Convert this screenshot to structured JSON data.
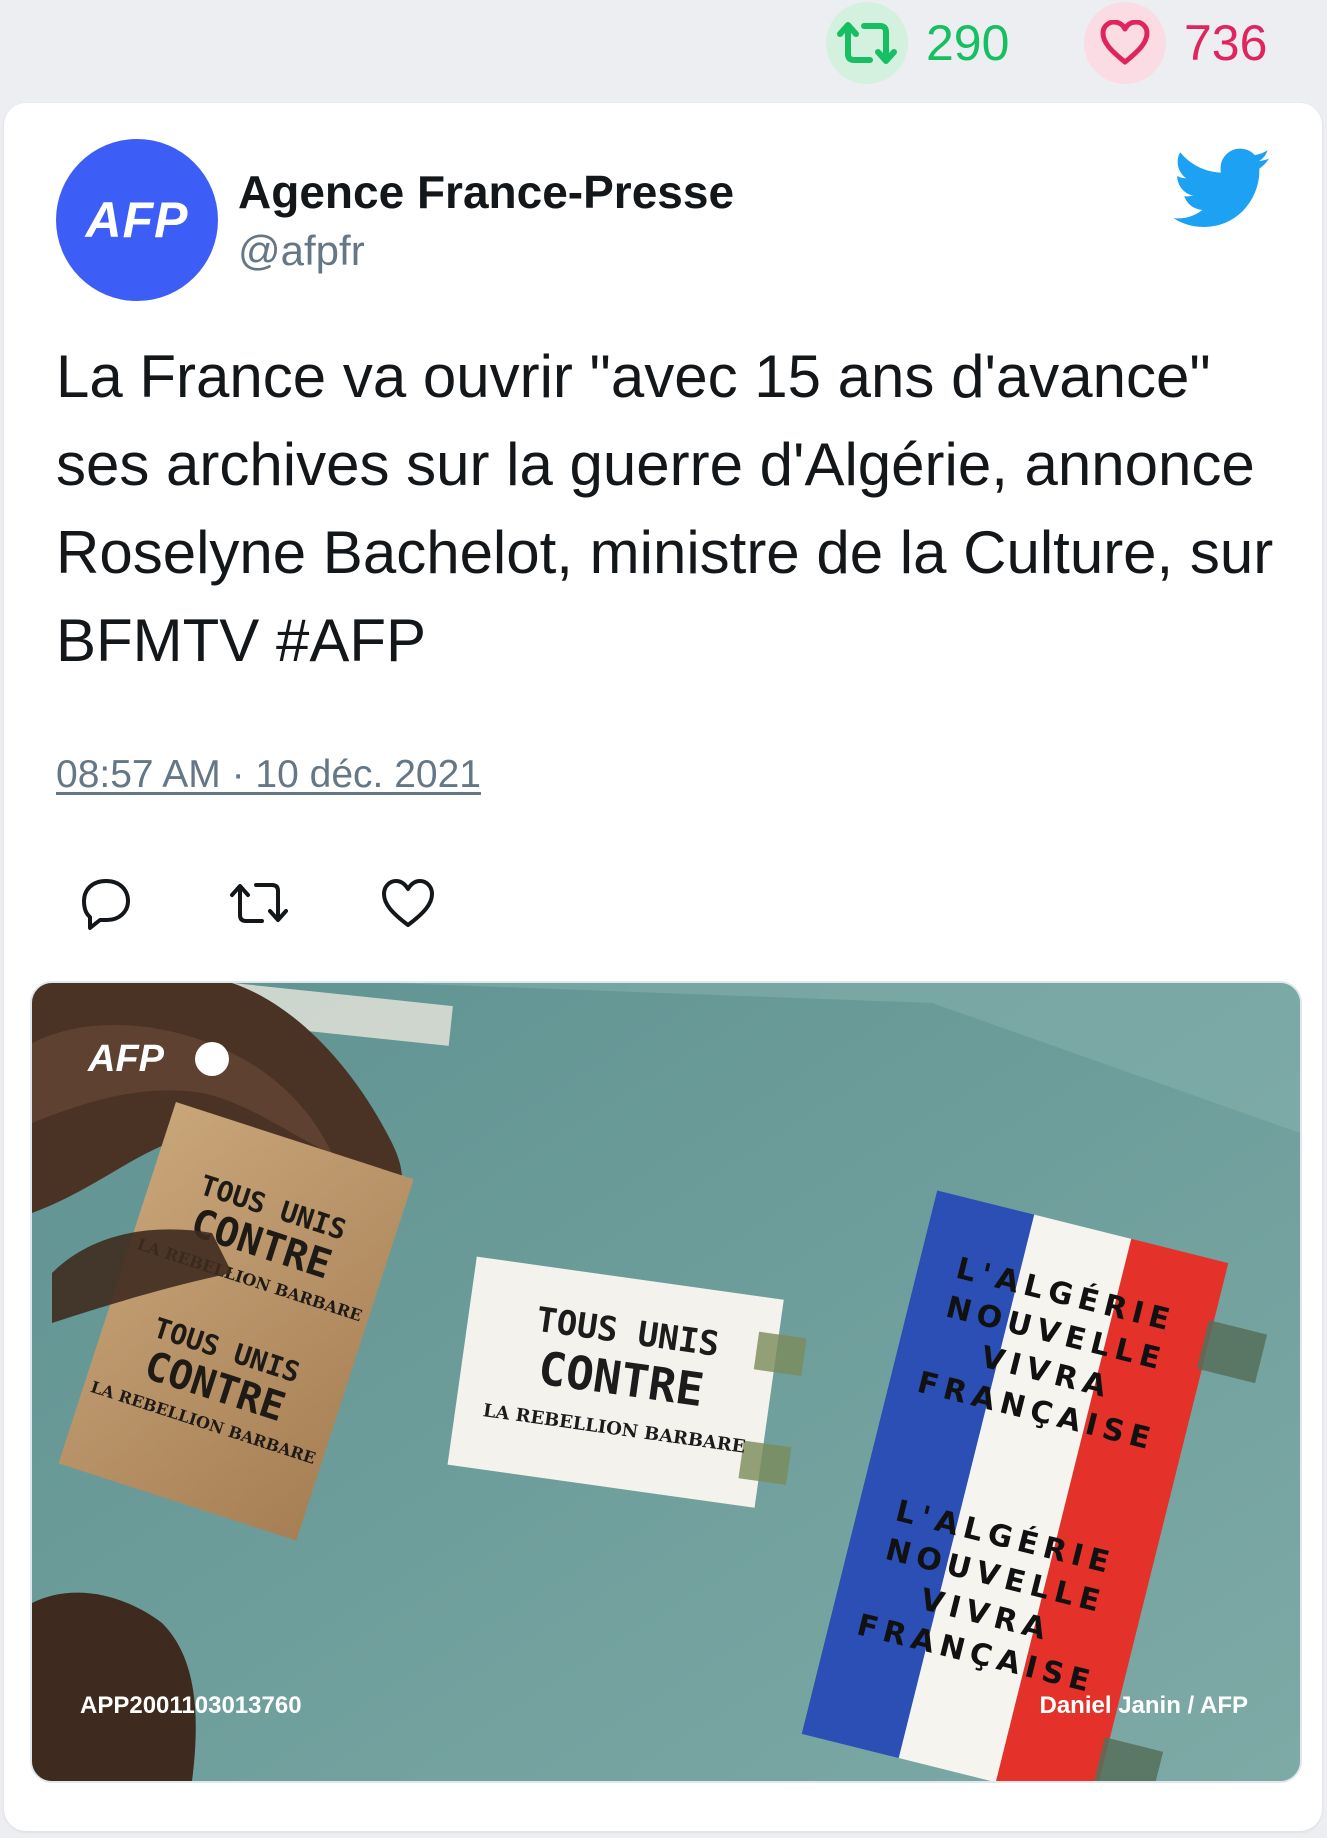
{
  "stats": {
    "retweets": "290",
    "likes": "736",
    "retweet_color": "#17bf63",
    "like_color": "#e0245e"
  },
  "author": {
    "avatar_text": "AFP",
    "name": "Agence France-Presse",
    "handle": "@afpfr"
  },
  "tweet": {
    "text": "La France va ouvrir \"avec 15 ans d'avance\" ses archives sur la guerre d'Algérie, annonce Roselyne Bachelot, ministre de la Culture, sur BFMTV #AFP",
    "timestamp": "08:57 AM · 10 déc. 2021"
  },
  "actions": [
    "reply-icon",
    "retweet-icon",
    "like-icon"
  ],
  "media": {
    "watermark": "AFP",
    "image_id": "APP2001103013760",
    "credit": "Daniel Janin / AFP",
    "poster_left_line1": "TOUS UNIS",
    "poster_left_line2": "CONTRE",
    "poster_left_line3": "LA REBELLION BARBARE",
    "poster_mid_line1": "TOUS UNIS",
    "poster_mid_line2": "CONTRE",
    "poster_mid_line3": "LA REBELLION BARBARE",
    "poster_right_line1": "L'ALGÉRIE",
    "poster_right_line2": "NOUVELLE",
    "poster_right_line3": "VIVRA",
    "poster_right_line4": "FRANÇAISE"
  }
}
